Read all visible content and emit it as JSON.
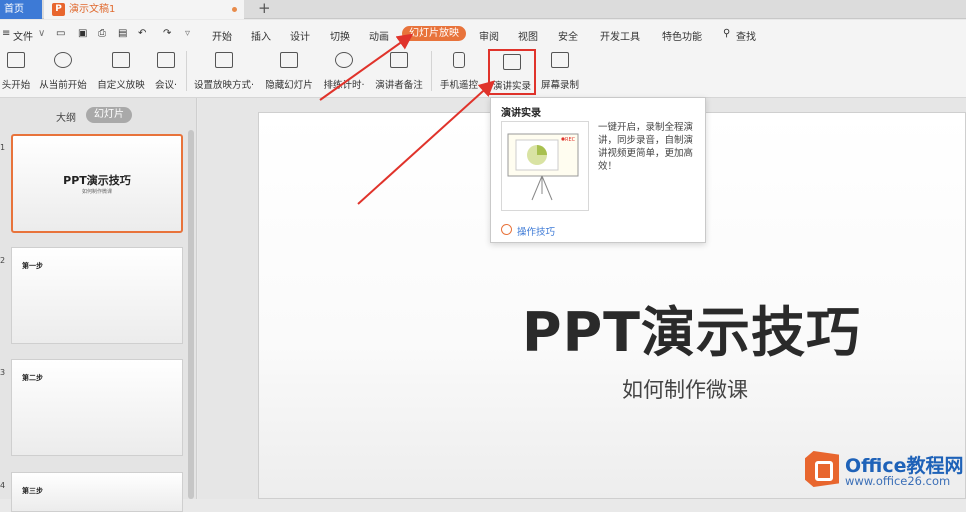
{
  "tabs": {
    "home": "首页",
    "document": "演示文稿1",
    "new_tab": "+"
  },
  "menubar": {
    "file": "文件",
    "items": [
      "开始",
      "插入",
      "设计",
      "切换",
      "动画",
      "幻灯片放映",
      "审阅",
      "视图",
      "安全",
      "开发工具",
      "特色功能"
    ],
    "active_index": 5,
    "search": "查找"
  },
  "ribbon": [
    "头开始",
    "从当前开始",
    "自定义放映",
    "会议·",
    "设置放映方式·",
    "隐藏幻灯片",
    "排练计时·",
    "演讲者备注",
    "手机遥控",
    "演讲实录",
    "屏幕录制"
  ],
  "leftpanel": {
    "outline_tab": "大纲",
    "slides_tab": "幻灯片",
    "thumbnails": [
      {
        "number": "1",
        "title": "PPT演示技巧",
        "subtitle": "如何制作微课"
      },
      {
        "number": "2",
        "title": "第一步"
      },
      {
        "number": "3",
        "title": "第二步"
      },
      {
        "number": "4",
        "title": "第三步"
      }
    ]
  },
  "slide": {
    "title": "PPT演示技巧",
    "subtitle": "如何制作微课"
  },
  "tooltip": {
    "title": "演讲实录",
    "description": "一键开启，录制全程演讲，同步录音，自制演讲视频更简单，更加高效！",
    "rec_label": "REC",
    "link": "操作技巧"
  },
  "watermark": {
    "line1": "Office教程网",
    "line2": "www.office26.com"
  },
  "colors": {
    "accent": "#e8733b",
    "highlight_box": "#e0332b",
    "arrow": "#e0332b",
    "link": "#3d7ad6"
  }
}
